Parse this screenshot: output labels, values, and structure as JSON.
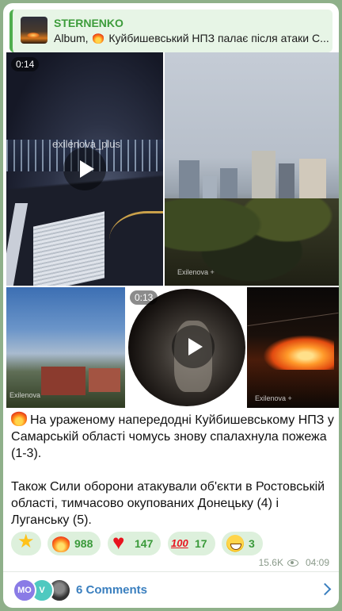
{
  "reply": {
    "channel_name": "STERNENKO",
    "prefix": "Album,",
    "text": "Куйбишевський НПЗ палає після атаки С..."
  },
  "media": {
    "video1_duration": "0:14",
    "video2_duration": "0:13",
    "watermark_1": "exilenova_plus",
    "watermark_2": "Exilenova +",
    "watermark_3": "Exilenova",
    "watermark_4": "Exilenova +"
  },
  "message": {
    "paragraph1": "На ураженому напередодні Куйбишевському НПЗ у Самарській області чомусь знову спалахнула пожежа (1-3).",
    "paragraph2": "Також Сили оборони атакували об'єкти в Ростовській області, тимчасово окупованих Донецьку (4) і Луганську (5)."
  },
  "reactions": [
    {
      "icon": "star-icon",
      "count": ""
    },
    {
      "icon": "fire-icon",
      "count": "988"
    },
    {
      "icon": "heart-icon",
      "count": "147"
    },
    {
      "icon": "hundred-icon",
      "count": "17"
    },
    {
      "icon": "grin-icon",
      "count": "3"
    }
  ],
  "meta": {
    "views": "15.6K",
    "time": "04:09"
  },
  "comments": {
    "avatar1_initials": "MO",
    "avatar2_initials": "V",
    "label": "6 Comments"
  },
  "colors": {
    "accent_green": "#3d9c3b",
    "link_blue": "#3a7fbf",
    "reaction_bg": "#ddf0dc"
  }
}
